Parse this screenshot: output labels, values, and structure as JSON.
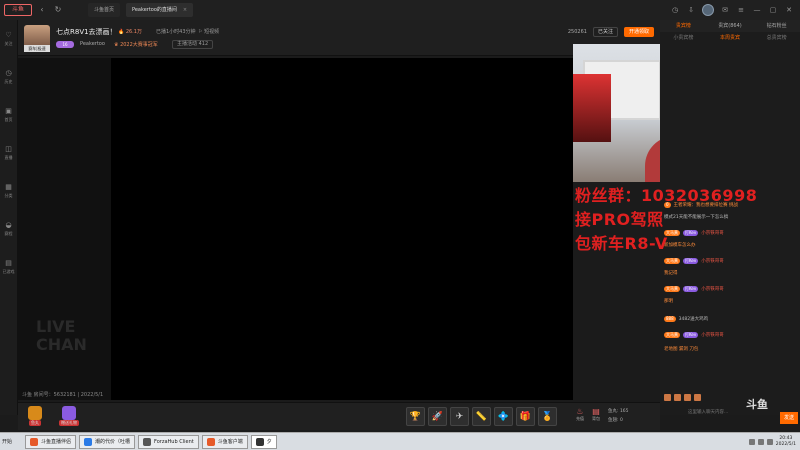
{
  "topbar": {
    "logo": "斗鱼",
    "back": "‹",
    "refresh": "↻",
    "tabs": [
      {
        "label": "斗鱼首页",
        "close": ""
      },
      {
        "label": "Peakertoo的直播间",
        "close": "×"
      }
    ]
  },
  "sidebar": {
    "items": [
      {
        "icon": "♡",
        "label": "关注"
      },
      {
        "icon": "◷",
        "label": "历史"
      },
      {
        "icon": "▣",
        "label": "首页"
      },
      {
        "icon": "◫",
        "label": "直播"
      },
      {
        "icon": "▦",
        "label": "分类"
      },
      {
        "icon": "◒",
        "label": "赛程"
      },
      {
        "icon": "▤",
        "label": "已游戏"
      }
    ]
  },
  "header": {
    "streamer_tag": "赛车|极速",
    "title": "七点R8V1去漂画！",
    "hot": "🔥 26.1万",
    "live_time": "已播1小时43分钟",
    "report": "⚐ 短视频",
    "level": "16",
    "streamer_name": "Peakertoo",
    "rank": "♛ 2022大赛事冠军",
    "official": "主播活动 412",
    "room_id": "250261",
    "follow_count": "已关注",
    "follow_btn": "开通领取"
  },
  "video": {
    "watermark": "LIVE\nCHAN",
    "footer": "斗鱼 房间号：5632181 | 2022/5/1"
  },
  "overlay": {
    "line1": "粉丝群：1032036998",
    "line2": "接PRO驾照",
    "line3": "包新车R8-V"
  },
  "chat": {
    "tabs": [
      "贵宾榜",
      "贵宾(864)",
      "钻石粉丝"
    ],
    "sub_tabs": [
      "小贵宾榜",
      "本周贵宾",
      "总贵宾榜"
    ],
    "messages": [
      {
        "badge1": "0",
        "text": "王者荣耀：我也想要排位赛 挑战"
      },
      {
        "badge1": "",
        "text": "模式21天能不能展示一下怎么搞"
      },
      {
        "badge1": "大马黄",
        "badge2": "打Kev",
        "text": "小宗铁哥哥"
      },
      {
        "badge1": "",
        "text": "新加模车怎么办"
      },
      {
        "badge1": "大马黄",
        "badge2": "打Kev",
        "text": "小宗铁哥哥"
      },
      {
        "badge1": "",
        "text": "我记得"
      },
      {
        "badge1": "大马黄",
        "badge2": "打Kev",
        "text": "小宗铁哥哥"
      },
      {
        "badge1": "",
        "text": "那明"
      },
      {
        "badge1": "888",
        "text": "3482送大鸡鸡"
      },
      {
        "badge1": "大马黄",
        "badge2": "打Kev",
        "text": "小宗铁哥哥"
      },
      {
        "badge1": "",
        "text": "老地图 漏洞 刀包"
      }
    ],
    "input_placeholder": "这里输入聊天内容...",
    "send": "发送",
    "logo": "斗鱼"
  },
  "giftbar": {
    "left": [
      "鱼丸",
      "赠送礼物"
    ],
    "gifts": [
      "🏆",
      "🚀",
      "✈",
      "📏",
      "💠",
      "🎁",
      "🏅"
    ],
    "right": [
      {
        "icon": "♨",
        "label": "充值"
      },
      {
        "icon": "▤",
        "label": "背包"
      }
    ],
    "currency": [
      "鱼丸: 165",
      "鱼翅: 0"
    ]
  },
  "taskbar": {
    "start": "开始",
    "tasks": [
      {
        "label": "斗鱼直播伴侣",
        "color": "#e65a2a"
      },
      {
        "label": "潮的代价（吐槽",
        "color": "#2a7ae6"
      },
      {
        "label": "ForzaHub Client",
        "color": "#555555"
      },
      {
        "label": "斗鱼客户端",
        "color": "#e65a2a"
      },
      {
        "label": "夕",
        "color": "#333333"
      }
    ],
    "time": "20:43",
    "date": "2022/5/1"
  },
  "colors": {
    "accent": "#ff6a00",
    "overlay_red": "#e02020"
  }
}
